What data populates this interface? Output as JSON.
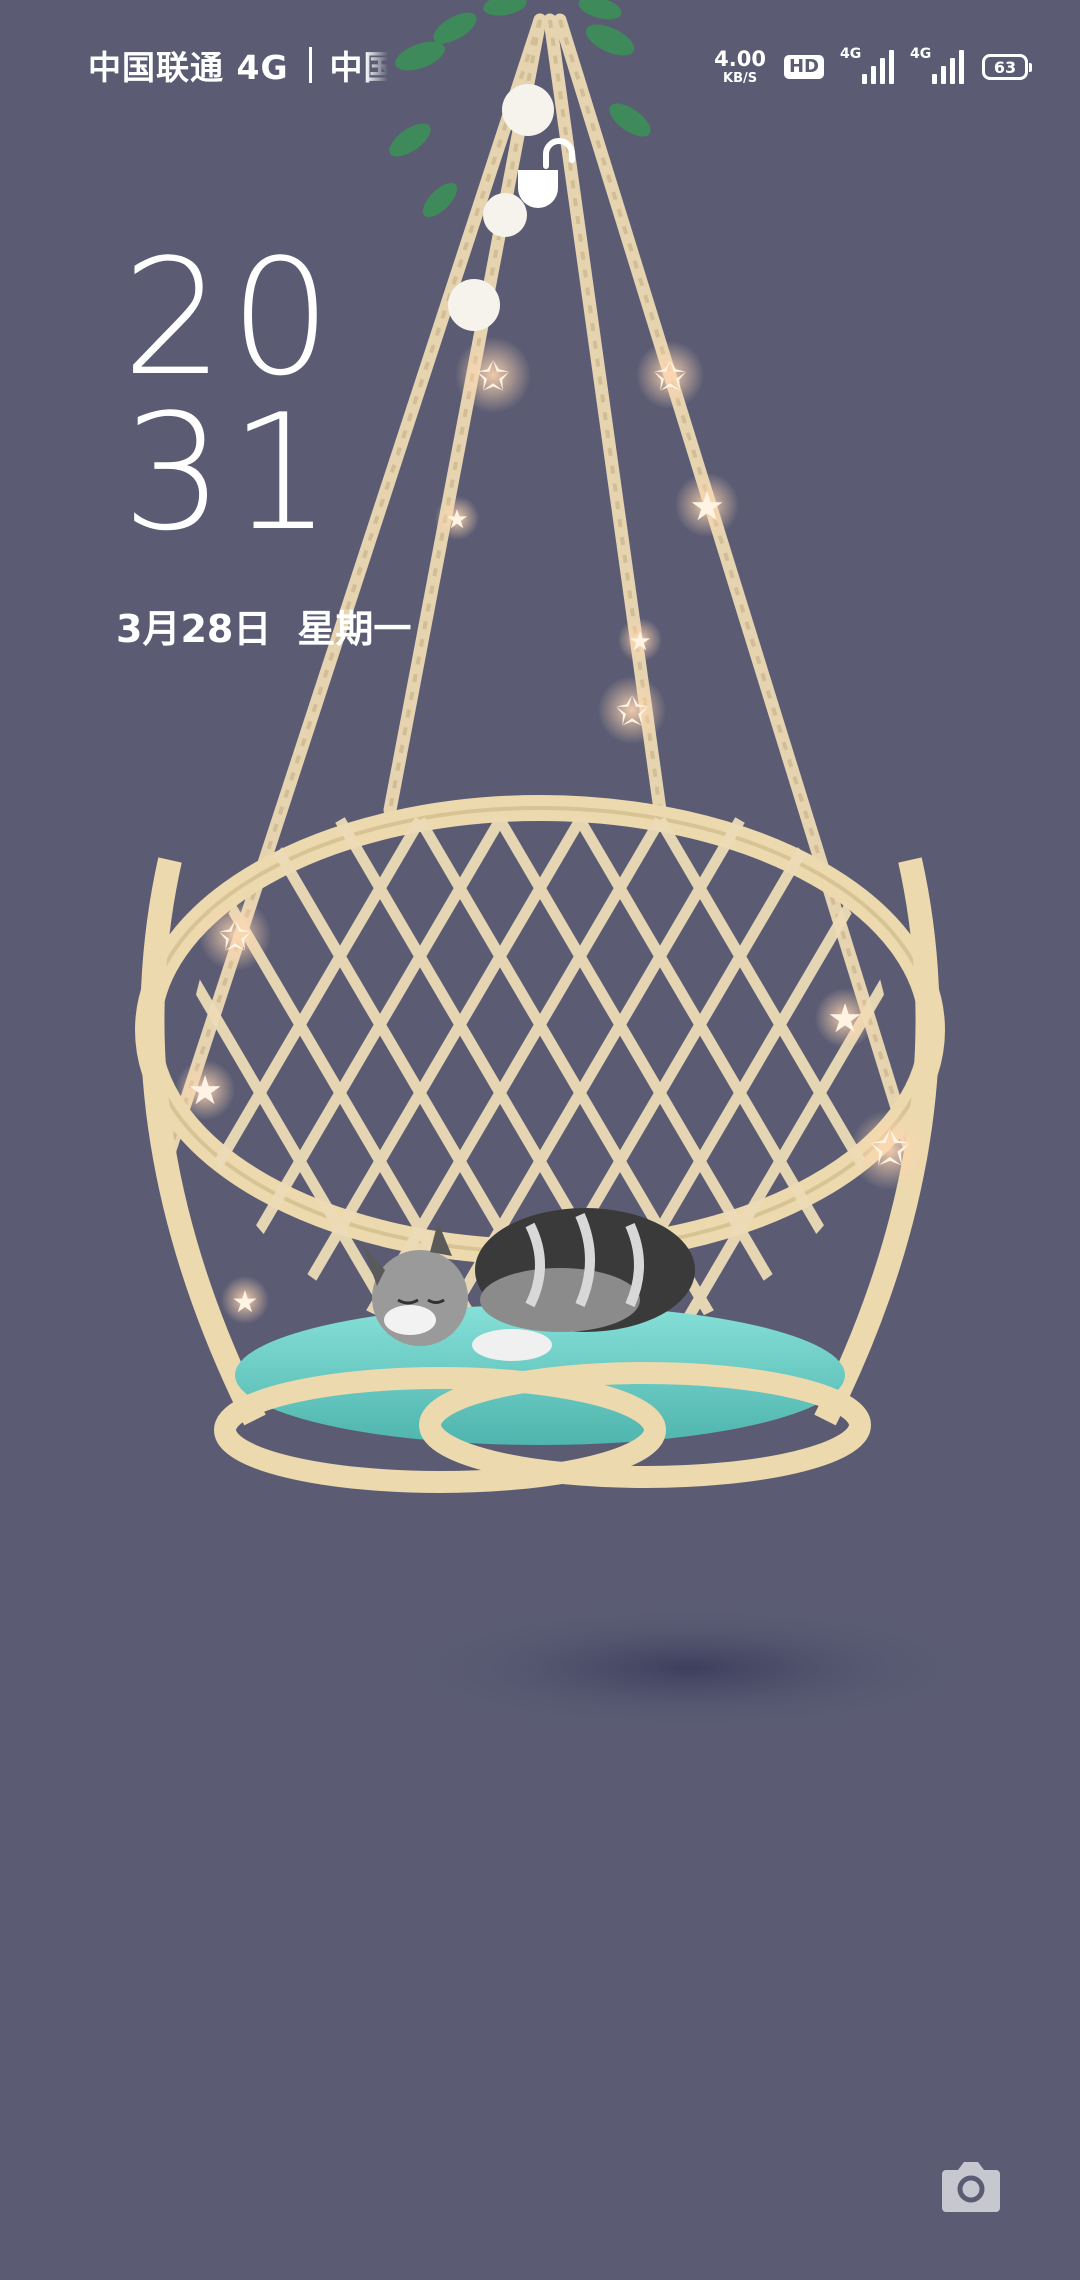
{
  "status_bar": {
    "carrier_1": "中国联通 4G",
    "carrier_2": "中国",
    "net_speed_value": "4.00",
    "net_speed_unit": "KB/S",
    "hd_label": "HD",
    "sim1_network": "4G",
    "sim2_network": "4G",
    "battery_level": "63"
  },
  "lock_screen": {
    "clock_hours": "20",
    "clock_minutes": "31",
    "date": "3月28日",
    "weekday": "星期一",
    "lock_icon": "unlocked-padlock-icon",
    "camera_icon": "camera-icon"
  },
  "colors": {
    "background": "#5b5c74",
    "rattan": "#e9d3a8",
    "cushion": "#6fcfc7",
    "star_glow": "#ffd6b0"
  }
}
